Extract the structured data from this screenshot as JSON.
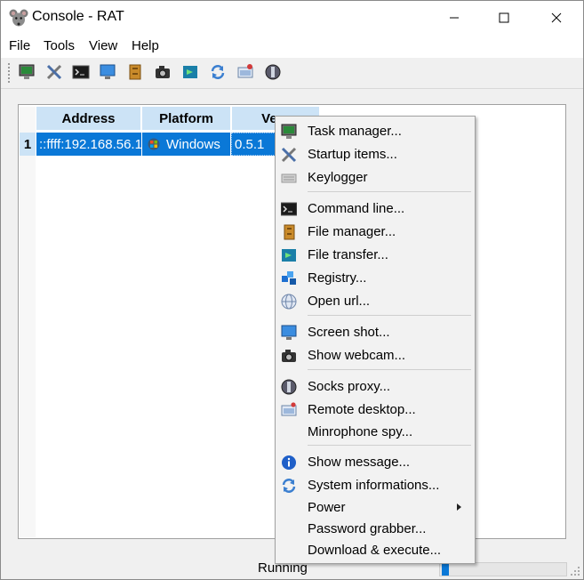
{
  "window": {
    "title": "Console - RAT",
    "icon": "rat-icon",
    "controls": [
      "minimize-icon",
      "maximize-icon",
      "close-icon"
    ]
  },
  "menubar": {
    "file": "File",
    "tools": "Tools",
    "view": "View",
    "help": "Help"
  },
  "toolbar": {
    "icons": [
      "task-manager-icon",
      "tools-icon",
      "command-line-icon",
      "screen-shot-icon",
      "file-manager-icon",
      "webcam-icon",
      "file-transfer-icon",
      "refresh-icon",
      "remote-desktop-icon",
      "socks-proxy-icon"
    ]
  },
  "table": {
    "columns": {
      "address": "Address",
      "platform": "Platform",
      "version": "Vers"
    },
    "rows": [
      {
        "num": "1",
        "address": "::ffff:192.168.56.1",
        "platform": "Windows",
        "platform_icon": "windows-logo-icon",
        "version": "0.5.1"
      }
    ]
  },
  "context_menu": {
    "items": [
      {
        "label": "Task manager...",
        "icon": "task-manager-icon"
      },
      {
        "label": "Startup items...",
        "icon": "tools-icon"
      },
      {
        "label": "Keylogger",
        "icon": "keyboard-icon"
      },
      {
        "label": "Command line...",
        "icon": "command-line-icon"
      },
      {
        "label": "File manager...",
        "icon": "file-manager-icon"
      },
      {
        "label": "File transfer...",
        "icon": "file-transfer-icon"
      },
      {
        "label": "Registry...",
        "icon": "registry-icon"
      },
      {
        "label": "Open url...",
        "icon": "globe-icon"
      },
      {
        "label": "Screen shot...",
        "icon": "screen-shot-icon"
      },
      {
        "label": "Show webcam...",
        "icon": "webcam-icon"
      },
      {
        "label": "Socks proxy...",
        "icon": "socks-proxy-icon"
      },
      {
        "label": "Remote desktop...",
        "icon": "remote-desktop-icon"
      },
      {
        "label": "Minrophone spy...",
        "icon": ""
      },
      {
        "label": "Show message...",
        "icon": "info-icon"
      },
      {
        "label": "System informations...",
        "icon": "refresh-icon"
      },
      {
        "label": "Power",
        "icon": "",
        "submenu": true
      },
      {
        "label": "Password grabber...",
        "icon": ""
      },
      {
        "label": "Download & execute...",
        "icon": ""
      }
    ]
  },
  "status": {
    "text": "Running",
    "progress": 0.06
  },
  "colors": {
    "selection": "#0a78d7",
    "header": "#cce3f6"
  }
}
